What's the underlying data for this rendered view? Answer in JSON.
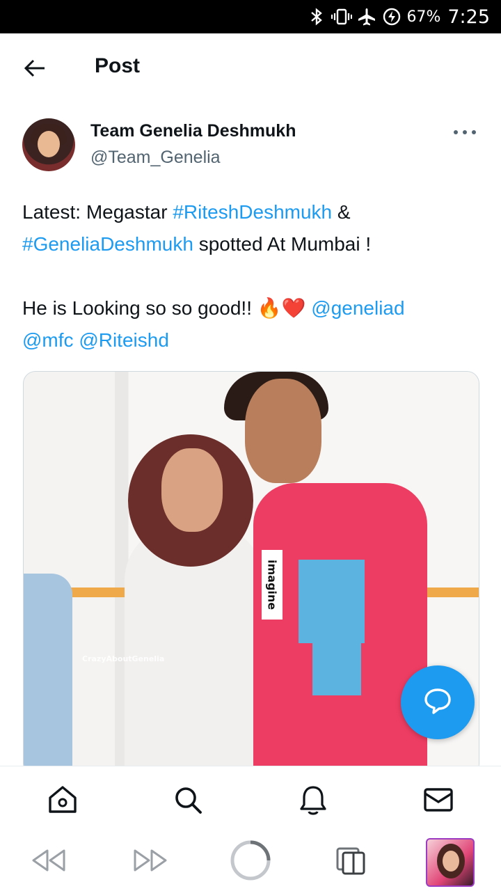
{
  "status_bar": {
    "icons": [
      "bluetooth-icon",
      "vibrate-icon",
      "airplane-icon",
      "battery-saver-icon"
    ],
    "battery": "67%",
    "time": "7:25"
  },
  "header": {
    "back_icon": "arrow-left-icon",
    "title": "Post"
  },
  "author": {
    "name": "Team Genelia Deshmukh",
    "handle": "@Team_Genelia",
    "more_icon": "more-horizontal-icon"
  },
  "tweet": {
    "line1_prefix": "Latest: Megastar ",
    "hashtag1": "#RiteshDeshmukh",
    "line1_suffix": " &",
    "hashtag2": "#GeneliaDeshmukh",
    "line2_suffix": " spotted At Mumbai !",
    "line3_prefix": "He is Looking so so good!! ",
    "emoji": "🔥❤️",
    "mention1": "@geneliad",
    "mention2": "@mfc",
    "mention3": "@Riteishd"
  },
  "media": {
    "watermark": "CrazyAboutGenelia",
    "shirt_tag": "imagine"
  },
  "fab": {
    "icon": "reply-bubble-icon"
  },
  "tabs": [
    {
      "name": "home",
      "icon": "home-icon"
    },
    {
      "name": "search",
      "icon": "search-icon"
    },
    {
      "name": "notifications",
      "icon": "bell-icon"
    },
    {
      "name": "messages",
      "icon": "mail-icon"
    }
  ],
  "nav": {
    "icons": [
      "rewind-icon",
      "fast-forward-icon",
      "home-circle-icon",
      "recent-apps-icon"
    ]
  },
  "colors": {
    "link": "#1d9bf0",
    "secondary_text": "#536471",
    "fab": "#1d9bf0"
  }
}
